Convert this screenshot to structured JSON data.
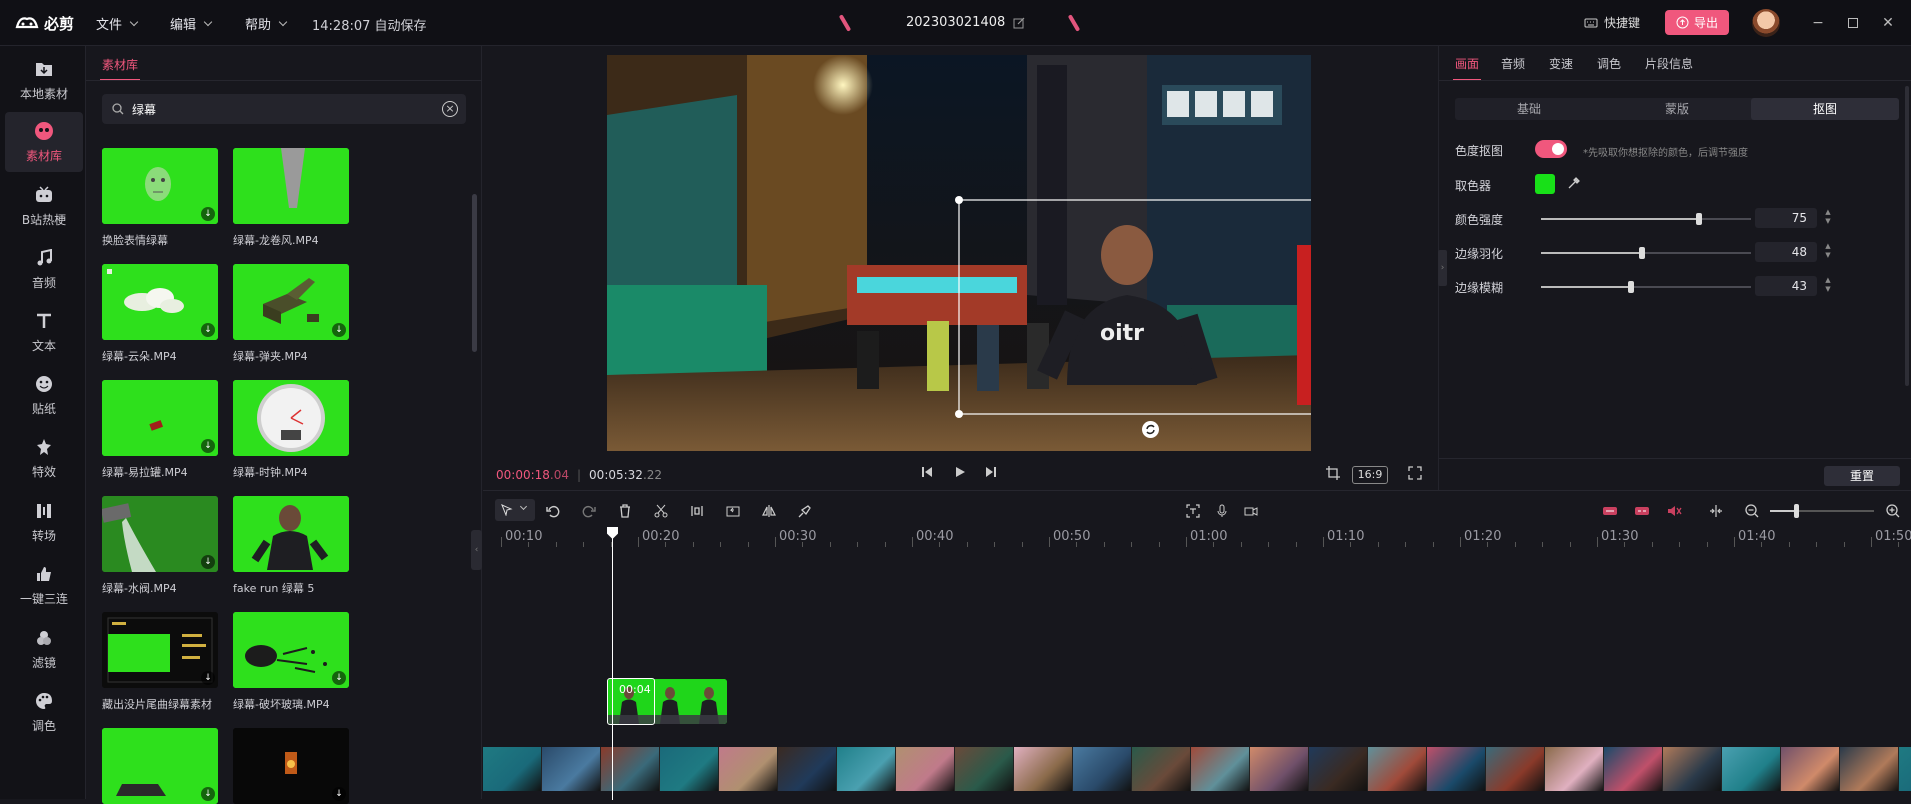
{
  "app": {
    "logo": "必剪"
  },
  "menus": [
    {
      "label": "文件"
    },
    {
      "label": "编辑"
    },
    {
      "label": "帮助"
    }
  ],
  "autosave": "14:28:07 自动保存",
  "project_title": "202303021408",
  "shortcut_label": "快捷键",
  "export_label": "导出",
  "leftnav": [
    {
      "label": "本地素材",
      "icon": "folder-icon"
    },
    {
      "label": "素材库",
      "icon": "library-icon"
    },
    {
      "label": "B站热梗",
      "icon": "tv-icon"
    },
    {
      "label": "音频",
      "icon": "music-icon"
    },
    {
      "label": "文本",
      "icon": "text-icon"
    },
    {
      "label": "贴纸",
      "icon": "sticker-icon"
    },
    {
      "label": "特效",
      "icon": "effects-icon"
    },
    {
      "label": "转场",
      "icon": "transition-icon"
    },
    {
      "label": "一键三连",
      "icon": "thumbs-up-icon"
    },
    {
      "label": "滤镜",
      "icon": "filter-icon"
    },
    {
      "label": "调色",
      "icon": "palette-icon"
    }
  ],
  "library": {
    "tab": "素材库",
    "search": {
      "value": "绿幕"
    },
    "items": [
      {
        "label": "换脸表情绿幕"
      },
      {
        "label": "绿幕-龙卷风.MP4"
      },
      {
        "label": "绿幕-云朵.MP4"
      },
      {
        "label": "绿幕-弹夹.MP4"
      },
      {
        "label": "绿幕-易拉罐.MP4"
      },
      {
        "label": "绿幕-时钟.MP4"
      },
      {
        "label": "绿幕-水阀.MP4"
      },
      {
        "label": "fake run 绿幕 5"
      },
      {
        "label": "藏出没片尾曲绿幕素材"
      },
      {
        "label": "绿幕-破坏玻璃.MP4"
      },
      {
        "label": ""
      },
      {
        "label": ""
      }
    ]
  },
  "preview": {
    "current_time": "00:00:18",
    "current_frames": ".04",
    "total_time": "00:05:32",
    "total_frames": ".22",
    "ratio": "16:9"
  },
  "props": {
    "tabs": [
      "画面",
      "音频",
      "变速",
      "调色",
      "片段信息"
    ],
    "segments": [
      "基础",
      "蒙版",
      "抠图"
    ],
    "chroma_label": "色度抠图",
    "chroma_on": true,
    "chroma_hint": "*先吸取你想抠除的颜色，后调节强度",
    "picker_label": "取色器",
    "picker_color": "#18e018",
    "sliders": [
      {
        "label": "颜色强度",
        "value": "75"
      },
      {
        "label": "边缘羽化",
        "value": "48"
      },
      {
        "label": "边缘模糊",
        "value": "43"
      }
    ],
    "reset_label": "重置"
  },
  "timeline": {
    "ruler": [
      "00:10",
      "00:20",
      "00:30",
      "00:40",
      "00:50",
      "01:00",
      "01:10",
      "01:20",
      "01:30",
      "01:40",
      "01:50"
    ],
    "clip_time": "00:04",
    "zoom_level": 0.25
  }
}
